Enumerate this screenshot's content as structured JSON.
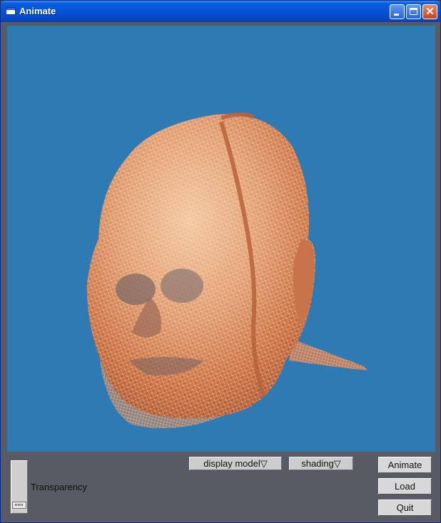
{
  "window": {
    "title": "Animate",
    "icons": {
      "app": "window-icon",
      "minimize": "minimize-icon",
      "maximize": "maximize-icon",
      "close": "close-icon"
    },
    "titlebar_color": "#0553d6",
    "viewport_background": "#2e7bb4"
  },
  "controls": {
    "transparency_label": "Transparency",
    "transparency_value": 0.0,
    "display_model_label": "display model",
    "display_model_arrow": "▽",
    "shading_label": "shading",
    "shading_arrow": "▽",
    "animate_label": "Animate",
    "load_label": "Load",
    "quit_label": "Quit",
    "panel_color": "#585a64"
  },
  "model": {
    "description_icon": "wireframe-head-mesh",
    "mesh_color": "#e0875a"
  }
}
